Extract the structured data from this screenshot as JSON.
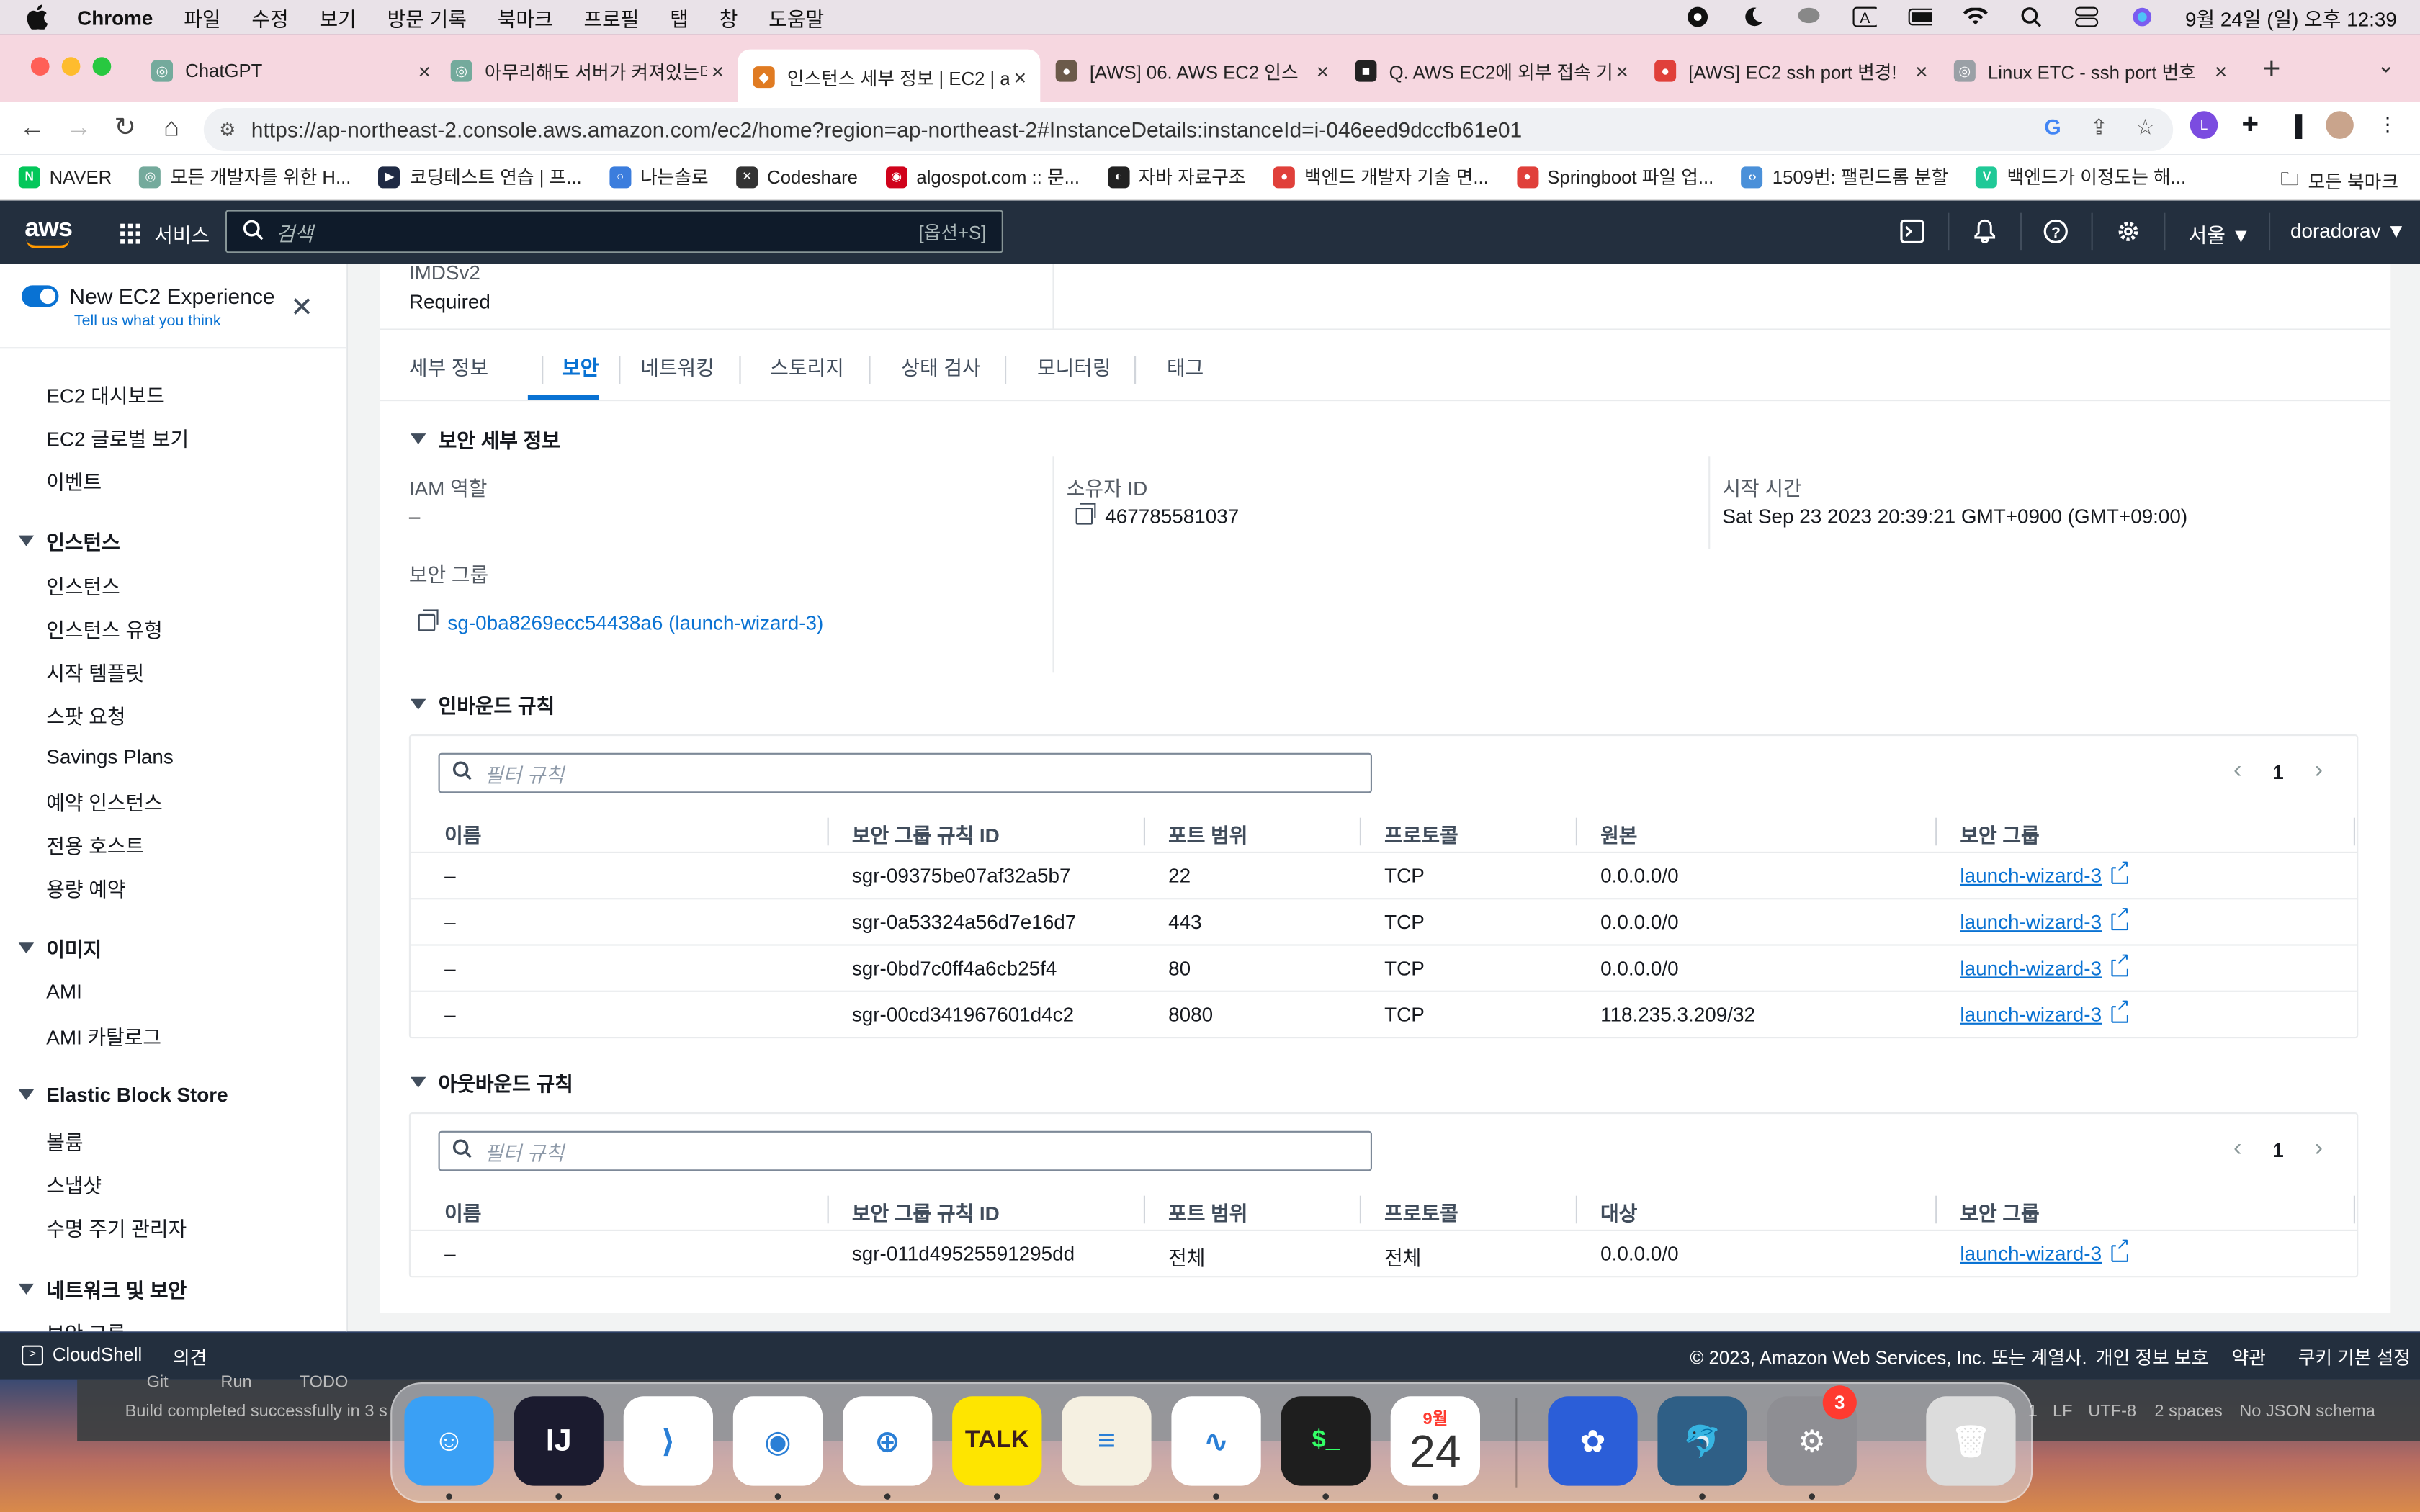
{
  "menubar": {
    "app": "Chrome",
    "menus": [
      "파일",
      "수정",
      "보기",
      "방문 기록",
      "북마크",
      "프로필",
      "탭",
      "창",
      "도움말"
    ],
    "clock": "9월 24일 (일) 오후 12:39"
  },
  "tabs": [
    {
      "label": "ChatGPT",
      "color": "#74aa9c",
      "glyph": "◎"
    },
    {
      "label": "아무리해도 서버가 켜져있는데",
      "color": "#74aa9c",
      "glyph": "◎"
    },
    {
      "label": "인스턴스 세부 정보 | EC2 | a",
      "color": "#e07b22",
      "glyph": "◆"
    },
    {
      "label": "[AWS] 06. AWS EC2 인스",
      "color": "#6b5a4a",
      "glyph": "●"
    },
    {
      "label": "Q. AWS EC2에 외부 접속 기",
      "color": "#222222",
      "glyph": "■"
    },
    {
      "label": "[AWS] EC2 ssh port 변경!",
      "color": "#e0403a",
      "glyph": "●"
    },
    {
      "label": "Linux ETC - ssh port 번호",
      "color": "#9aa0a6",
      "glyph": "◎"
    }
  ],
  "address": {
    "url": "https://ap-northeast-2.console.aws.amazon.com/ec2/home?region=ap-northeast-2#InstanceDetails:instanceId=i-046eed9dccfb61e01"
  },
  "bookmarks": [
    {
      "label": "NAVER",
      "color": "#03c75a",
      "glyph": "N"
    },
    {
      "label": "모든 개발자를 위한 H...",
      "color": "#74aa9c",
      "glyph": "◎"
    },
    {
      "label": "코딩테스트 연습 | 프...",
      "color": "#1f2a44",
      "glyph": "▶"
    },
    {
      "label": "나는솔로",
      "color": "#3b7ddd",
      "glyph": "○"
    },
    {
      "label": "Codeshare",
      "color": "#333333",
      "glyph": "✕"
    },
    {
      "label": "algospot.com :: 문...",
      "color": "#d0021b",
      "glyph": "◉"
    },
    {
      "label": "자바 자료구조",
      "color": "#222222",
      "glyph": "◐"
    },
    {
      "label": "백엔드 개발자 기술 면...",
      "color": "#e0403a",
      "glyph": "●"
    },
    {
      "label": "Springboot 파일 업...",
      "color": "#e0403a",
      "glyph": "●"
    },
    {
      "label": "1509번: 팰린드롬 분할",
      "color": "#4a90d9",
      "glyph": "‹›"
    },
    {
      "label": "백엔드가 이정도는 해...",
      "color": "#20c997",
      "glyph": "V"
    }
  ],
  "bookmarks_all": "모든 북마크",
  "aws_header": {
    "logo": "aws",
    "services": "서비스",
    "search_placeholder": "검색",
    "search_shortcut": "[옵션+S]",
    "region": "서울 ▼",
    "user": "doradorav ▼"
  },
  "sidebar": {
    "new_experience": "New EC2 Experience",
    "tell_us": "Tell us what you think",
    "top_items": [
      "EC2 대시보드",
      "EC2 글로벌 보기",
      "이벤트"
    ],
    "sections": [
      {
        "title": "인스턴스",
        "items": [
          "인스턴스",
          "인스턴스 유형",
          "시작 템플릿",
          "스팟 요청",
          "Savings Plans",
          "예약 인스턴스",
          "전용 호스트",
          "용량 예약"
        ]
      },
      {
        "title": "이미지",
        "items": [
          "AMI",
          "AMI 카탈로그"
        ]
      },
      {
        "title": "Elastic Block Store",
        "items": [
          "볼륨",
          "스냅샷",
          "수명 주기 관리자"
        ]
      },
      {
        "title": "네트워크 및 보안",
        "items": [
          "보안 그룹"
        ]
      }
    ]
  },
  "instance": {
    "imds_label": "IMDSv2",
    "imds_value": "Required"
  },
  "detail_tabs": [
    "세부 정보",
    "보안",
    "네트워킹",
    "스토리지",
    "상태 검사",
    "모니터링",
    "태그"
  ],
  "security": {
    "title": "보안 세부 정보",
    "iam_label": "IAM 역할",
    "iam_value": "–",
    "owner_label": "소유자 ID",
    "owner_value": "467785581037",
    "launch_label": "시작 시간",
    "launch_value": "Sat Sep 23 2023 20:39:21 GMT+0900 (GMT+09:00)",
    "sg_label": "보안 그룹",
    "sg_value": "sg-0ba8269ecc54438a6 (launch-wizard-3)"
  },
  "inbound": {
    "title": "인바운드 규칙",
    "filter_placeholder": "필터 규칙",
    "page": "1",
    "headers": [
      "이름",
      "보안 그룹 규칙 ID",
      "포트 범위",
      "프로토콜",
      "원본",
      "보안 그룹"
    ],
    "rows": [
      [
        "–",
        "sgr-09375be07af32a5b7",
        "22",
        "TCP",
        "0.0.0.0/0",
        "launch-wizard-3"
      ],
      [
        "–",
        "sgr-0a53324a56d7e16d7",
        "443",
        "TCP",
        "0.0.0.0/0",
        "launch-wizard-3"
      ],
      [
        "–",
        "sgr-0bd7c0ff4a6cb25f4",
        "80",
        "TCP",
        "0.0.0.0/0",
        "launch-wizard-3"
      ],
      [
        "–",
        "sgr-00cd341967601d4c2",
        "8080",
        "TCP",
        "118.235.3.209/32",
        "launch-wizard-3"
      ]
    ]
  },
  "outbound": {
    "title": "아웃바운드 규칙",
    "filter_placeholder": "필터 규칙",
    "page": "1",
    "headers": [
      "이름",
      "보안 그룹 규칙 ID",
      "포트 범위",
      "프로토콜",
      "대상",
      "보안 그룹"
    ],
    "rows": [
      [
        "–",
        "sgr-011d49525591295dd",
        "전체",
        "전체",
        "0.0.0.0/0",
        "launch-wizard-3"
      ]
    ]
  },
  "footer": {
    "cloudshell": "CloudShell",
    "feedback": "의견",
    "copyright": "© 2023, Amazon Web Services, Inc. 또는 계열사.",
    "privacy": "개인 정보 보호",
    "terms": "약관",
    "cookies": "쿠키 기본 설정"
  },
  "ide": {
    "tools": [
      "Git",
      "Run",
      "TODO"
    ],
    "status": "Build completed successfully in 3 s",
    "right": [
      "1",
      "LF",
      "UTF-8",
      "2 spaces",
      "No JSON schema"
    ]
  },
  "dock": {
    "calendar_month": "9월",
    "calendar_day": "24",
    "badge": "3",
    "apps": [
      {
        "name": "finder",
        "color": "#3aa0f5",
        "glyph": "☺"
      },
      {
        "name": "intellij",
        "color": "#1b1b2f",
        "glyph": "IJ"
      },
      {
        "name": "vscode",
        "color": "#ffffff",
        "glyph": "⟩"
      },
      {
        "name": "chrome",
        "color": "#ffffff",
        "glyph": "◉"
      },
      {
        "name": "safari",
        "color": "#ffffff",
        "glyph": "⊕"
      },
      {
        "name": "kakaotalk",
        "color": "#fee500",
        "glyph": "TALK"
      },
      {
        "name": "notes",
        "color": "#f5f0e1",
        "glyph": "≡"
      },
      {
        "name": "freeform",
        "color": "#ffffff",
        "glyph": "∿"
      },
      {
        "name": "terminal",
        "color": "#1e1e1e",
        "glyph": "$_"
      },
      {
        "name": "calendar",
        "color": "#ffffff",
        "glyph": ""
      },
      {
        "name": "grape",
        "color": "#2b5ed8",
        "glyph": "✿"
      },
      {
        "name": "mysql-workbench",
        "color": "#2f5f86",
        "glyph": "🐬"
      },
      {
        "name": "system-settings",
        "color": "#8e8e93",
        "glyph": "⚙"
      },
      {
        "name": "trash",
        "color": "#dcdcdc",
        "glyph": "🗑"
      }
    ]
  }
}
